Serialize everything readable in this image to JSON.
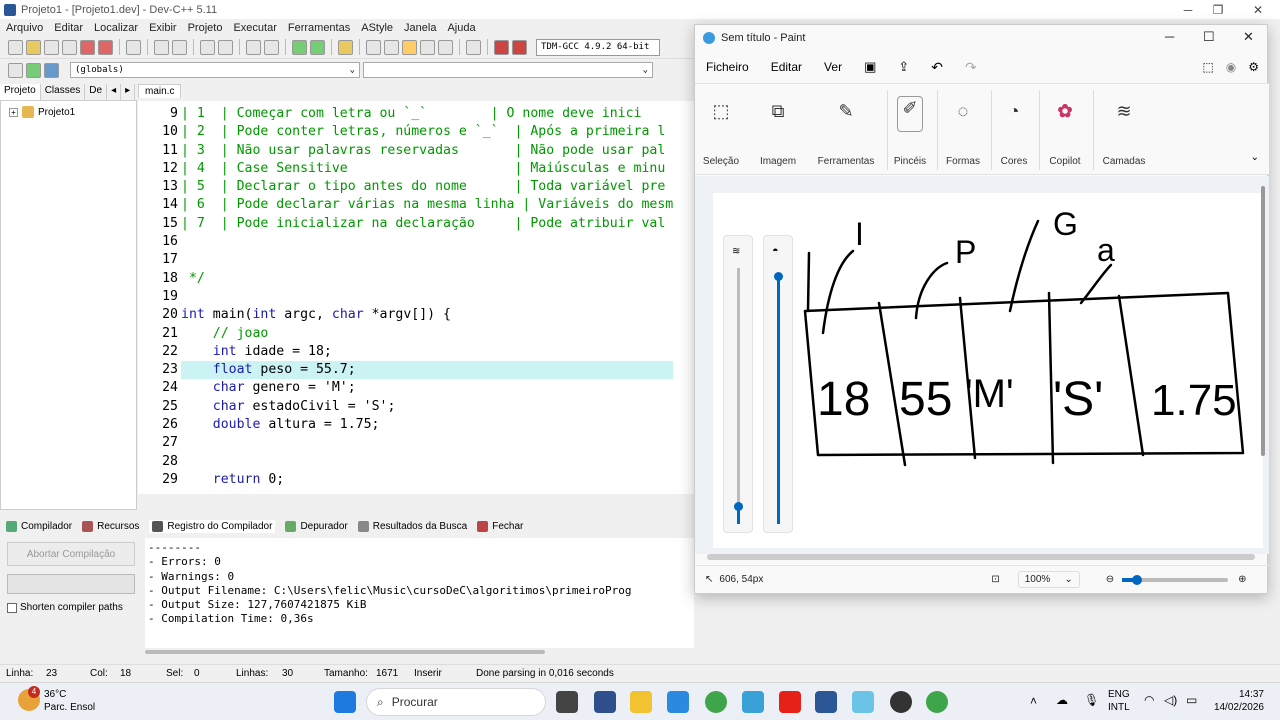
{
  "devcpp": {
    "title": "Projeto1 - [Projeto1.dev] - Dev-C++ 5.11",
    "menu": [
      "Arquivo",
      "Editar",
      "Localizar",
      "Exibir",
      "Projeto",
      "Executar",
      "Ferramentas",
      "AStyle",
      "Janela",
      "Ajuda"
    ],
    "compiler": "TDM-GCC 4.9.2 64-bit",
    "scope_combo": "(globals)",
    "left_tabs": [
      "Projeto",
      "Classes",
      "De"
    ],
    "project_root": "Projeto1",
    "file_tab": "main.c",
    "line_numbers": [
      "9",
      "10",
      "11",
      "12",
      "13",
      "14",
      "15",
      "16",
      "17",
      "18",
      "19",
      "20",
      "21",
      "22",
      "23",
      "24",
      "25",
      "26",
      "27",
      "28",
      "29"
    ],
    "code_lines": [
      "| 1  | Começar com letra ou `_`        | O nome deve inici",
      "| 2  | Pode conter letras, números e `_`  | Após a primeira l",
      "| 3  | Não usar palavras reservadas       | Não pode usar pal",
      "| 4  | Case Sensitive                     | Maiúsculas e minu",
      "| 5  | Declarar o tipo antes do nome      | Toda variável pre",
      "| 6  | Pode declarar várias na mesma linha | Variáveis do mesm",
      "| 7  | Pode inicializar na declaração     | Pode atribuir val",
      "",
      "",
      " */",
      "",
      "int main(int argc, char *argv[]) {",
      "    // joao",
      "    int idade = 18;",
      "    float peso = 55.7;",
      "    char genero = 'M';",
      "    char estadoCivil = 'S';",
      "    double altura = 1.75;",
      "",
      "",
      "    return 0;"
    ],
    "bottom_tabs": [
      "Compilador",
      "Recursos",
      "Registro do Compilador",
      "Depurador",
      "Resultados da Busca",
      "Fechar"
    ],
    "abort_button": "Abortar Compilação",
    "shorten_paths": "Shorten compiler paths",
    "log_lines": [
      "--------",
      "- Errors: 0",
      "- Warnings: 0",
      "- Output Filename: C:\\Users\\felic\\Music\\cursoDeC\\algoritimos\\primeiroProg",
      "- Output Size: 127,7607421875 KiB",
      "- Compilation Time: 0,36s"
    ],
    "status": {
      "linha_label": "Linha:",
      "linha": "23",
      "col_label": "Col:",
      "col": "18",
      "sel_label": "Sel:",
      "sel": "0",
      "linhas_label": "Linhas:",
      "linhas": "30",
      "tamanho_label": "Tamanho:",
      "tamanho": "1671",
      "mode": "Inserir",
      "parse": "Done parsing in 0,016 seconds"
    }
  },
  "paint": {
    "title": "Sem título - Paint",
    "menu": [
      "Ficheiro",
      "Editar",
      "Ver"
    ],
    "ribbon": [
      "Seleção",
      "Imagem",
      "Ferramentas",
      "Pincéis",
      "Formas",
      "Cores",
      "Copilot",
      "Camadas"
    ],
    "drawing_labels": [
      "I",
      "P",
      "G",
      "a"
    ],
    "drawing_cells": [
      "18",
      "55",
      "'M'",
      "'S'",
      "1.75"
    ],
    "cursor_pos": "606, 54px",
    "zoom": "100%"
  },
  "taskbar": {
    "temp": "36°C",
    "weather": "Parc. Ensol",
    "weather_badge": "4",
    "search": "Procurar",
    "lang1": "ENG",
    "lang2": "INTL",
    "time": "14:37",
    "date": "14/02/2026"
  },
  "colors": {
    "accent": "#0067c0",
    "comment": "#009900",
    "keyword": "#1b1bb0",
    "highlight": "#ccf3f3"
  }
}
